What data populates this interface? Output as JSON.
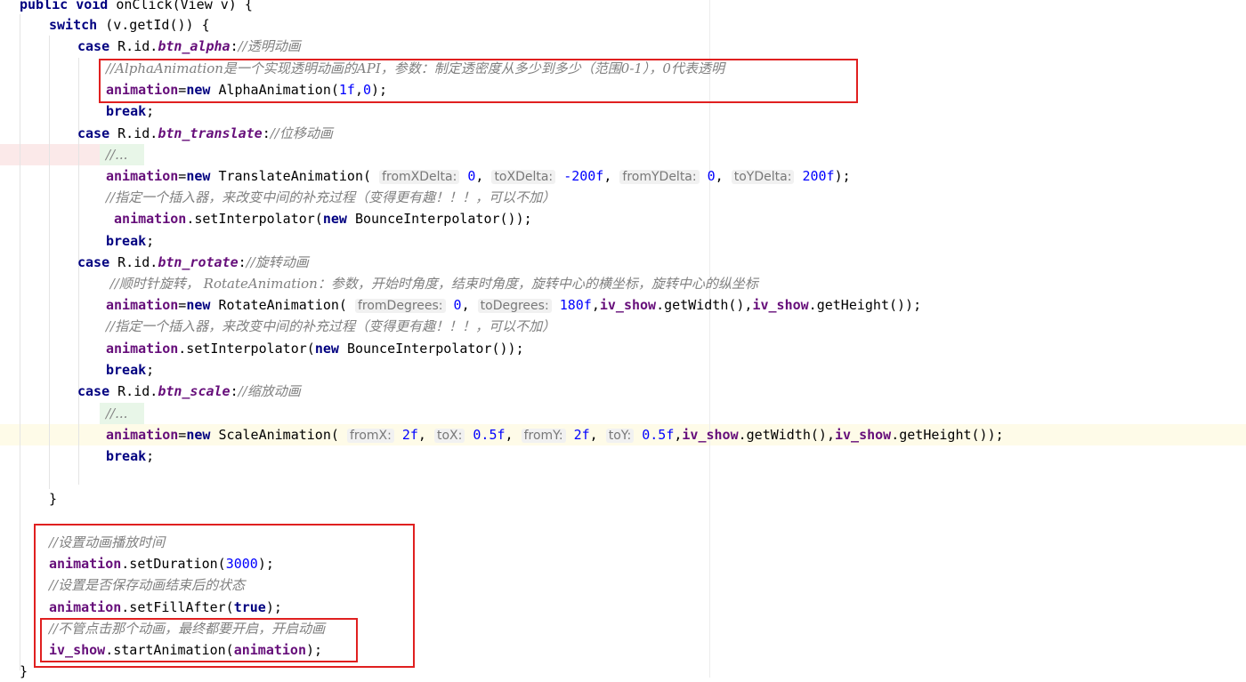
{
  "editor": {
    "lines": [
      {
        "tokens": [
          {
            "k": "kw",
            "t": "public void "
          },
          {
            "k": "p",
            "t": "onClick(View v) {"
          }
        ]
      },
      {
        "tokens": [
          {
            "k": "kw",
            "t": "switch "
          },
          {
            "k": "p",
            "t": "(v.getId()) {"
          }
        ]
      },
      {
        "tokens": [
          {
            "k": "kw",
            "t": "case "
          },
          {
            "k": "p",
            "t": "R.id."
          },
          {
            "k": "fd",
            "t": "btn_alpha"
          },
          {
            "k": "p",
            "t": ":"
          },
          {
            "k": "cm",
            "t": "//透明动画"
          }
        ]
      },
      {
        "tokens": [
          {
            "k": "cm",
            "t": "//AlphaAnimation是一个实现透明动画的API，参数：制定透密度从多少到多少（范围0-1），0代表透明"
          }
        ]
      },
      {
        "tokens": [
          {
            "k": "vr",
            "t": "animation"
          },
          {
            "k": "p",
            "t": "="
          },
          {
            "k": "kw",
            "t": "new "
          },
          {
            "k": "p",
            "t": "AlphaAnimation("
          },
          {
            "k": "num",
            "t": "1f"
          },
          {
            "k": "p",
            "t": ","
          },
          {
            "k": "num",
            "t": "0"
          },
          {
            "k": "p",
            "t": ");"
          }
        ]
      },
      {
        "tokens": [
          {
            "k": "kw",
            "t": "break"
          },
          {
            "k": "p",
            "t": ";"
          }
        ]
      },
      {
        "tokens": [
          {
            "k": "kw",
            "t": "case "
          },
          {
            "k": "p",
            "t": "R.id."
          },
          {
            "k": "fd",
            "t": "btn_translate"
          },
          {
            "k": "p",
            "t": ":"
          },
          {
            "k": "cm",
            "t": "//位移动画"
          }
        ]
      },
      {
        "tokens": [
          {
            "k": "cm",
            "t": "//..."
          }
        ]
      },
      {
        "tokens": [
          {
            "k": "vr",
            "t": "animation"
          },
          {
            "k": "p",
            "t": "="
          },
          {
            "k": "kw",
            "t": "new "
          },
          {
            "k": "p",
            "t": "TranslateAnimation( "
          },
          {
            "k": "hint",
            "t": "fromXDelta:"
          },
          {
            "k": "p",
            "t": " "
          },
          {
            "k": "num",
            "t": "0"
          },
          {
            "k": "p",
            "t": ", "
          },
          {
            "k": "hint",
            "t": "toXDelta:"
          },
          {
            "k": "p",
            "t": " "
          },
          {
            "k": "num",
            "t": "-200f"
          },
          {
            "k": "p",
            "t": ", "
          },
          {
            "k": "hint",
            "t": "fromYDelta:"
          },
          {
            "k": "p",
            "t": " "
          },
          {
            "k": "num",
            "t": "0"
          },
          {
            "k": "p",
            "t": ", "
          },
          {
            "k": "hint",
            "t": "toYDelta:"
          },
          {
            "k": "p",
            "t": " "
          },
          {
            "k": "num",
            "t": "200f"
          },
          {
            "k": "p",
            "t": ");"
          }
        ]
      },
      {
        "tokens": [
          {
            "k": "cm",
            "t": "//指定一个插入器，来改变中间的补充过程（变得更有趣！！！，可以不加）"
          }
        ]
      },
      {
        "tokens": [
          {
            "k": "p",
            "t": " "
          },
          {
            "k": "vr",
            "t": "animation"
          },
          {
            "k": "p",
            "t": ".setInterpolator("
          },
          {
            "k": "kw",
            "t": "new "
          },
          {
            "k": "p",
            "t": "BounceInterpolator());"
          }
        ]
      },
      {
        "tokens": [
          {
            "k": "kw",
            "t": "break"
          },
          {
            "k": "p",
            "t": ";"
          }
        ]
      },
      {
        "tokens": [
          {
            "k": "kw",
            "t": "case "
          },
          {
            "k": "p",
            "t": "R.id."
          },
          {
            "k": "fd",
            "t": "btn_rotate"
          },
          {
            "k": "p",
            "t": ":"
          },
          {
            "k": "cm",
            "t": "//旋转动画"
          }
        ]
      },
      {
        "tokens": [
          {
            "k": "cm",
            "t": " //顺时针旋转， RotateAnimation：参数，开始时角度，结束时角度，旋转中心的横坐标，旋转中心的纵坐标"
          }
        ]
      },
      {
        "tokens": [
          {
            "k": "vr",
            "t": "animation"
          },
          {
            "k": "p",
            "t": "="
          },
          {
            "k": "kw",
            "t": "new "
          },
          {
            "k": "p",
            "t": "RotateAnimation( "
          },
          {
            "k": "hint",
            "t": "fromDegrees:"
          },
          {
            "k": "p",
            "t": " "
          },
          {
            "k": "num",
            "t": "0"
          },
          {
            "k": "p",
            "t": ", "
          },
          {
            "k": "hint",
            "t": "toDegrees:"
          },
          {
            "k": "p",
            "t": " "
          },
          {
            "k": "num",
            "t": "180f"
          },
          {
            "k": "p",
            "t": ","
          },
          {
            "k": "vr",
            "t": "iv_show"
          },
          {
            "k": "p",
            "t": ".getWidth(),"
          },
          {
            "k": "vr",
            "t": "iv_show"
          },
          {
            "k": "p",
            "t": ".getHeight());"
          }
        ]
      },
      {
        "tokens": [
          {
            "k": "cm",
            "t": "//指定一个插入器，来改变中间的补充过程（变得更有趣！！！，可以不加）"
          }
        ]
      },
      {
        "tokens": [
          {
            "k": "vr",
            "t": "animation"
          },
          {
            "k": "p",
            "t": ".setInterpolator("
          },
          {
            "k": "kw",
            "t": "new "
          },
          {
            "k": "p",
            "t": "BounceInterpolator());"
          }
        ]
      },
      {
        "tokens": [
          {
            "k": "kw",
            "t": "break"
          },
          {
            "k": "p",
            "t": ";"
          }
        ]
      },
      {
        "tokens": [
          {
            "k": "kw",
            "t": "case "
          },
          {
            "k": "p",
            "t": "R.id."
          },
          {
            "k": "fd",
            "t": "btn_scale"
          },
          {
            "k": "p",
            "t": ":"
          },
          {
            "k": "cm",
            "t": "//缩放动画"
          }
        ]
      },
      {
        "tokens": [
          {
            "k": "cm",
            "t": "//..."
          }
        ]
      },
      {
        "tokens": [
          {
            "k": "vr",
            "t": "animation"
          },
          {
            "k": "p",
            "t": "="
          },
          {
            "k": "kw",
            "t": "new "
          },
          {
            "k": "p",
            "t": "ScaleAnimation( "
          },
          {
            "k": "hint",
            "t": "fromX:"
          },
          {
            "k": "p",
            "t": " "
          },
          {
            "k": "num",
            "t": "2f"
          },
          {
            "k": "p",
            "t": ", "
          },
          {
            "k": "hint",
            "t": "toX:"
          },
          {
            "k": "p",
            "t": " "
          },
          {
            "k": "num",
            "t": "0.5f"
          },
          {
            "k": "p",
            "t": ", "
          },
          {
            "k": "hint",
            "t": "fromY:"
          },
          {
            "k": "p",
            "t": " "
          },
          {
            "k": "num",
            "t": "2f"
          },
          {
            "k": "p",
            "t": ", "
          },
          {
            "k": "hint",
            "t": "toY:"
          },
          {
            "k": "p",
            "t": " "
          },
          {
            "k": "num",
            "t": "0.5f"
          },
          {
            "k": "p",
            "t": ","
          },
          {
            "k": "vr",
            "t": "iv_show"
          },
          {
            "k": "p",
            "t": ".getWidth(),"
          },
          {
            "k": "vr",
            "t": "iv_show"
          },
          {
            "k": "p",
            "t": ".getHeight());"
          }
        ]
      },
      {
        "tokens": [
          {
            "k": "kw",
            "t": "break"
          },
          {
            "k": "p",
            "t": ";"
          }
        ]
      },
      {
        "tokens": []
      },
      {
        "tokens": [
          {
            "k": "p",
            "t": "}"
          }
        ]
      },
      {
        "tokens": []
      },
      {
        "tokens": [
          {
            "k": "cm",
            "t": "//设置动画播放时间"
          }
        ]
      },
      {
        "tokens": [
          {
            "k": "vr",
            "t": "animation"
          },
          {
            "k": "p",
            "t": ".setDuration("
          },
          {
            "k": "num",
            "t": "3000"
          },
          {
            "k": "p",
            "t": ");"
          }
        ]
      },
      {
        "tokens": [
          {
            "k": "cm",
            "t": "//设置是否保存动画结束后的状态"
          }
        ]
      },
      {
        "tokens": [
          {
            "k": "vr",
            "t": "animation"
          },
          {
            "k": "p",
            "t": ".setFillAfter("
          },
          {
            "k": "kw",
            "t": "true"
          },
          {
            "k": "p",
            "t": ");"
          }
        ]
      },
      {
        "tokens": [
          {
            "k": "cm",
            "t": "//不管点击那个动画，最终都要开启，开启动画"
          }
        ]
      },
      {
        "tokens": [
          {
            "k": "vr",
            "t": "iv_show"
          },
          {
            "k": "p",
            "t": ".startAnimation("
          },
          {
            "k": "vr",
            "t": "animation"
          },
          {
            "k": "p",
            "t": ");"
          }
        ]
      },
      {
        "tokens": [
          {
            "k": "p",
            "t": "}"
          }
        ]
      }
    ]
  },
  "colors": {
    "keyword": "#000080",
    "comment": "#808080",
    "field": "#660e7a",
    "number": "#0000ff",
    "annotation_box": "#e02020"
  }
}
